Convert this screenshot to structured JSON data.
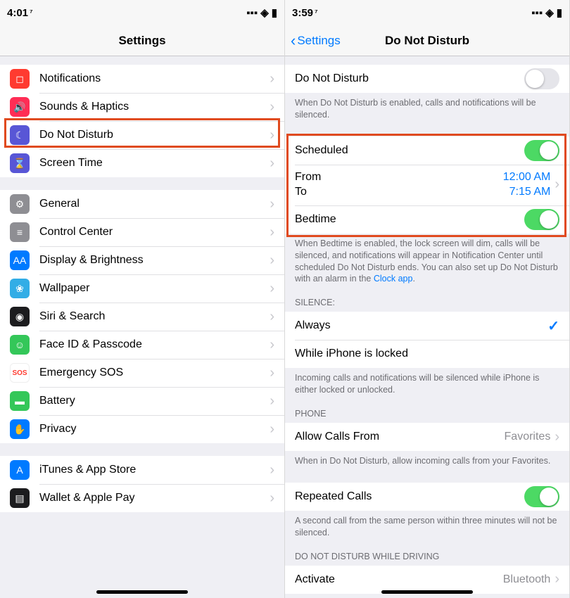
{
  "left": {
    "time": "4:01",
    "title": "Settings",
    "groups": [
      [
        {
          "icon": "notifications-icon",
          "bg": "bg-red",
          "glyph": "◻",
          "label": "Notifications"
        },
        {
          "icon": "sounds-icon",
          "bg": "bg-pink",
          "glyph": "🔊",
          "label": "Sounds & Haptics"
        },
        {
          "icon": "dnd-icon",
          "bg": "bg-purple",
          "glyph": "☾",
          "label": "Do Not Disturb",
          "highlight": true
        },
        {
          "icon": "screentime-icon",
          "bg": "bg-purple2",
          "glyph": "⌛",
          "label": "Screen Time"
        }
      ],
      [
        {
          "icon": "general-icon",
          "bg": "bg-gray",
          "glyph": "⚙",
          "label": "General"
        },
        {
          "icon": "controlcenter-icon",
          "bg": "bg-gray",
          "glyph": "≡",
          "label": "Control Center"
        },
        {
          "icon": "display-icon",
          "bg": "bg-blue",
          "glyph": "AA",
          "label": "Display & Brightness"
        },
        {
          "icon": "wallpaper-icon",
          "bg": "bg-cyan",
          "glyph": "❀",
          "label": "Wallpaper"
        },
        {
          "icon": "siri-icon",
          "bg": "bg-black",
          "glyph": "◉",
          "label": "Siri & Search"
        },
        {
          "icon": "faceid-icon",
          "bg": "bg-green",
          "glyph": "☺",
          "label": "Face ID & Passcode"
        },
        {
          "icon": "sos-icon",
          "bg": "bg-sos",
          "glyph": "SOS",
          "label": "Emergency SOS"
        },
        {
          "icon": "battery-icon",
          "bg": "bg-green",
          "glyph": "▬",
          "label": "Battery"
        },
        {
          "icon": "privacy-icon",
          "bg": "bg-priv",
          "glyph": "✋",
          "label": "Privacy"
        }
      ],
      [
        {
          "icon": "appstore-icon",
          "bg": "bg-store",
          "glyph": "A",
          "label": "iTunes & App Store"
        },
        {
          "icon": "wallet-icon",
          "bg": "bg-wallet",
          "glyph": "▤",
          "label": "Wallet & Apple Pay"
        }
      ]
    ]
  },
  "right": {
    "time": "3:59",
    "back": "Settings",
    "title": "Do Not Disturb",
    "dnd_row": {
      "label": "Do Not Disturb",
      "on": false
    },
    "dnd_footer": "When Do Not Disturb is enabled, calls and notifications will be silenced.",
    "scheduled": {
      "label": "Scheduled",
      "on": true
    },
    "from_label": "From",
    "from_value": "12:00 AM",
    "to_label": "To",
    "to_value": "7:15 AM",
    "bedtime": {
      "label": "Bedtime",
      "on": true
    },
    "bedtime_footer_a": "When Bedtime is enabled, the lock screen will dim, calls will be silenced, and notifications will appear in Notification Center until scheduled Do Not Disturb ends. You can also set up Do Not Disturb with an alarm in the ",
    "bedtime_footer_link": "Clock app",
    "silence_header": "SILENCE:",
    "silence_always": "Always",
    "silence_locked": "While iPhone is locked",
    "silence_footer": "Incoming calls and notifications will be silenced while iPhone is either locked or unlocked.",
    "phone_header": "PHONE",
    "allow_calls_label": "Allow Calls From",
    "allow_calls_value": "Favorites",
    "allow_calls_footer": "When in Do Not Disturb, allow incoming calls from your Favorites.",
    "repeated": {
      "label": "Repeated Calls",
      "on": true
    },
    "repeated_footer": "A second call from the same person within three minutes will not be silenced.",
    "driving_header": "DO NOT DISTURB WHILE DRIVING",
    "activate_label": "Activate",
    "activate_value": "Bluetooth"
  }
}
